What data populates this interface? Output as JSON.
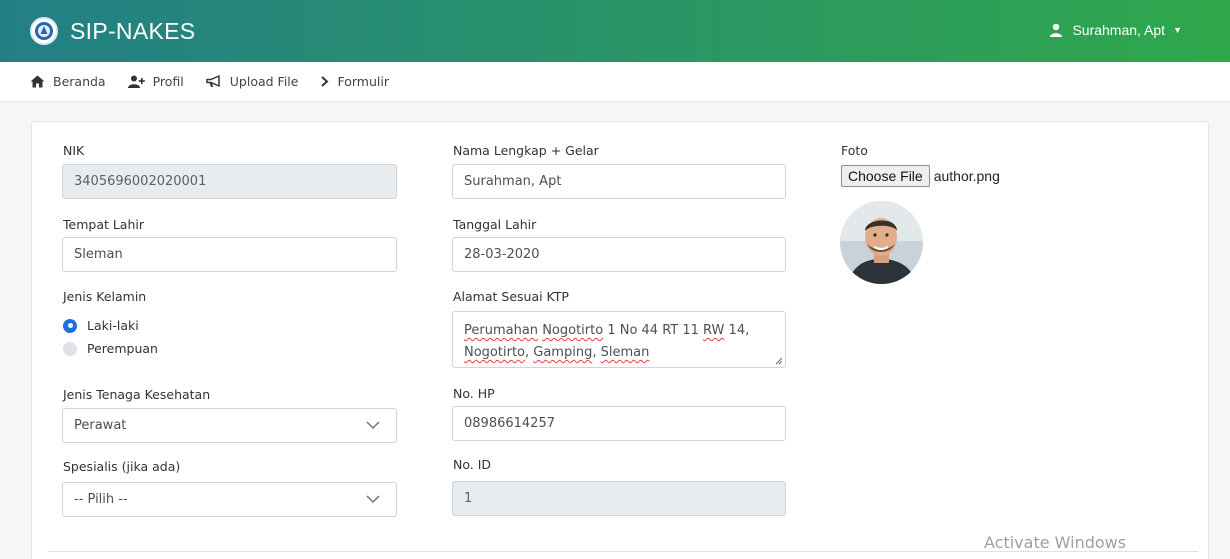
{
  "app": {
    "title": "SIP-NAKES"
  },
  "user": {
    "name": "Surahman, Apt"
  },
  "breadcrumb": [
    {
      "label": "Beranda"
    },
    {
      "label": "Profil"
    },
    {
      "label": "Upload File"
    },
    {
      "label": "Formulir"
    }
  ],
  "form": {
    "nik": {
      "label": "NIK",
      "value": "3405696002020001"
    },
    "tempat_lahir": {
      "label": "Tempat Lahir",
      "value": "Sleman"
    },
    "jenis_kelamin": {
      "label": "Jenis Kelamin",
      "options": [
        "Laki-laki",
        "Perempuan"
      ],
      "selected": "Laki-laki"
    },
    "jenis_tenaga": {
      "label": "Jenis Tenaga Kesehatan",
      "value": "Perawat"
    },
    "spesialis": {
      "label": "Spesialis (jika ada)",
      "value": "-- Pilih --"
    },
    "nama": {
      "label": "Nama Lengkap + Gelar",
      "value": "Surahman, Apt"
    },
    "tanggal_lahir": {
      "label": "Tanggal Lahir",
      "value": "28-03-2020"
    },
    "alamat": {
      "label": "Alamat Sesuai KTP",
      "line1_parts": [
        "Perumahan",
        " ",
        "Nogotirto",
        " 1 No 44 RT 11 ",
        "RW",
        " 14,"
      ],
      "line2_parts": [
        "Nogotirto",
        ", ",
        "Gamping",
        ", ",
        "Sleman"
      ]
    },
    "no_hp": {
      "label": "No. HP",
      "value": "08986614257"
    },
    "no_id": {
      "label": "No. ID",
      "value": "1"
    },
    "foto": {
      "label": "Foto",
      "button": "Choose File",
      "filename": "author.png"
    }
  },
  "watermark": {
    "text": "Activate Windows"
  },
  "colors": {
    "navbar_start": "#237f86",
    "navbar_end": "#2fa84c",
    "radio_on": "#1f6fe0"
  }
}
